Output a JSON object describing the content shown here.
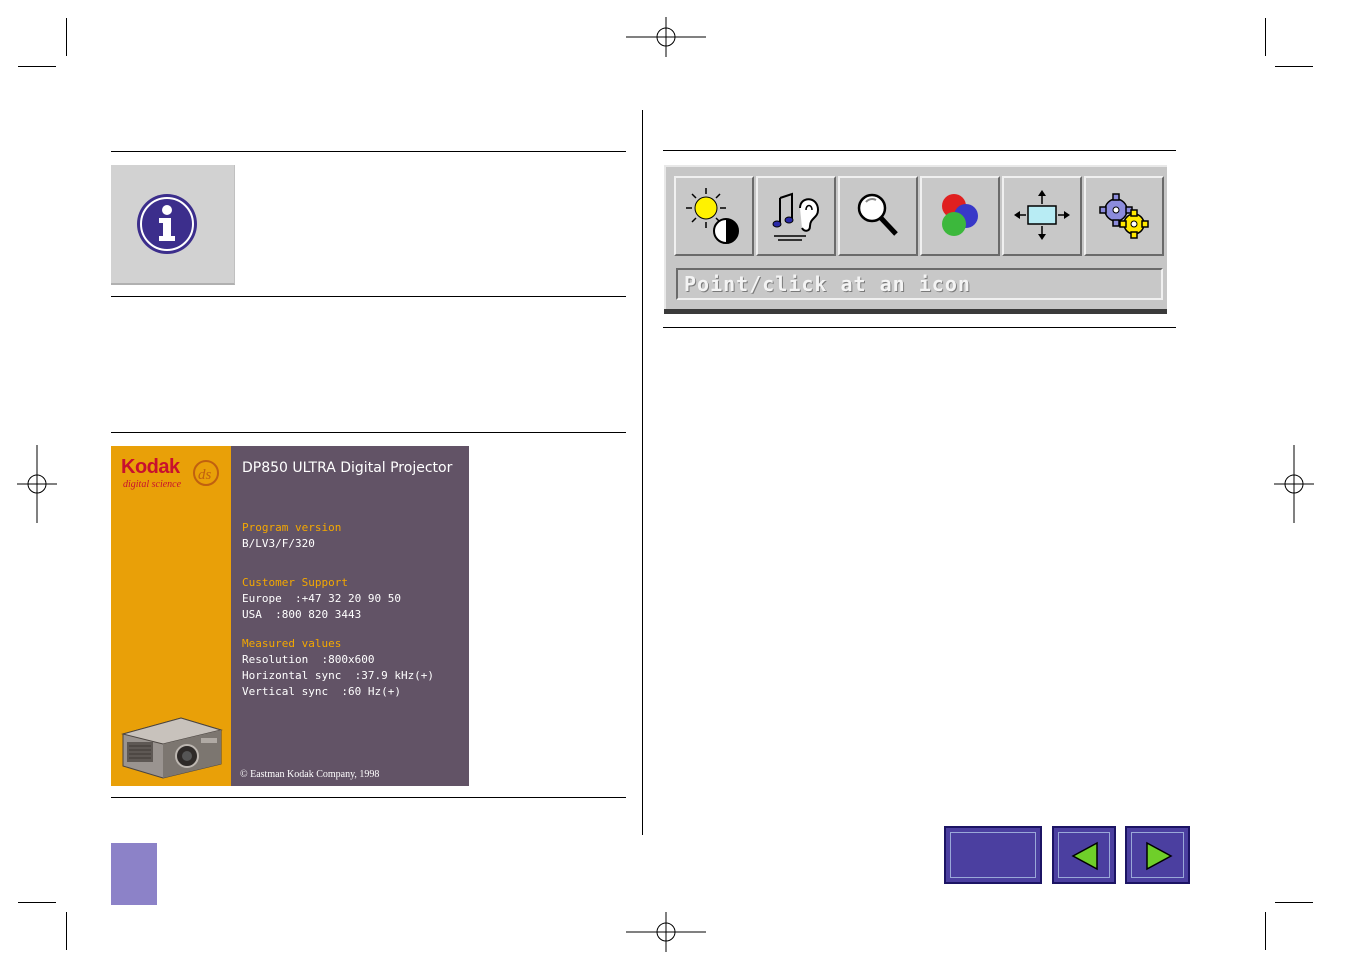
{
  "colors": {
    "rules": "#000000",
    "info_icon": "#3c2e8c",
    "kodak_orange": "#e9a008",
    "kodak_panel": "#625366",
    "nav_button": "#4b3fa0",
    "nav_arrow": "#6fcf2a",
    "corner_tab": "#8c82c8"
  },
  "info_block": {
    "icon": "info-icon"
  },
  "toolbar": {
    "buttons": [
      {
        "icon": "brightness-contrast-icon"
      },
      {
        "icon": "audio-icon"
      },
      {
        "icon": "zoom-icon"
      },
      {
        "icon": "color-icon"
      },
      {
        "icon": "picture-size-icon"
      },
      {
        "icon": "settings-gears-icon"
      }
    ],
    "status_text": "Point/click at an icon"
  },
  "kodak_screen": {
    "brand": "Kodak",
    "brand_sub": "digital science",
    "product": "DP850 ULTRA Digital Projector",
    "program_version_label": "Program version",
    "program_version": "B/LV3/F/320",
    "support_label": "Customer Support",
    "support_europe": "Europe  :+47 32 20 90 50",
    "support_usa": "USA  :800 820 3443",
    "measured_label": "Measured values",
    "resolution": "Resolution  :800x600",
    "hsync": "Horizontal sync  :37.9 kHz(+)",
    "vsync": "Vertical sync  :60 Hz(+)",
    "copyright": "© Eastman Kodak Company, 1998"
  },
  "navigation": {
    "home_icon": "home-button",
    "prev_icon": "previous-arrow-icon",
    "next_icon": "next-arrow-icon"
  }
}
